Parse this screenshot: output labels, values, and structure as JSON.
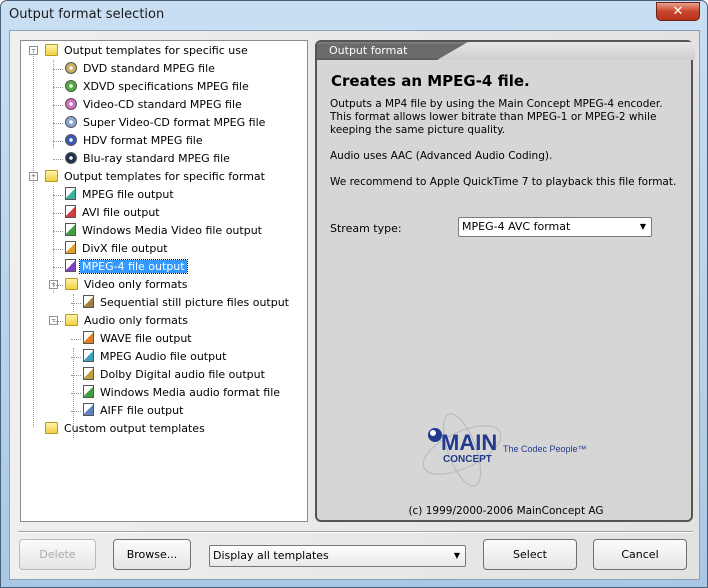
{
  "window": {
    "title": "Output format selection",
    "close_icon": "close-icon"
  },
  "tree": [
    {
      "label": "Output templates for specific use",
      "level": 0,
      "icon": "folder",
      "expander": "-"
    },
    {
      "label": "DVD standard MPEG file",
      "level": 1,
      "icon": "disc",
      "color": "#c8b060"
    },
    {
      "label": "XDVD specifications MPEG file",
      "level": 1,
      "icon": "disc",
      "color": "#50b040"
    },
    {
      "label": "Video-CD standard MPEG file",
      "level": 1,
      "icon": "disc",
      "color": "#d070c8"
    },
    {
      "label": "Super Video-CD format MPEG file",
      "level": 1,
      "icon": "disc",
      "color": "#8aa8d8"
    },
    {
      "label": "HDV format MPEG file",
      "level": 1,
      "icon": "disc",
      "color": "#3a5ab0"
    },
    {
      "label": "Blu-ray standard MPEG file",
      "level": 1,
      "icon": "disc",
      "color": "#203050"
    },
    {
      "label": "Output templates for specific format",
      "level": 0,
      "icon": "folder",
      "expander": "-"
    },
    {
      "label": "MPEG file output",
      "level": 1,
      "icon": "file",
      "color": "#40b0a0"
    },
    {
      "label": "AVI file output",
      "level": 1,
      "icon": "file",
      "color": "#d04040"
    },
    {
      "label": "Windows Media Video file output",
      "level": 1,
      "icon": "file",
      "color": "#40a040"
    },
    {
      "label": "DivX file output",
      "level": 1,
      "icon": "file",
      "color": "#e0a020"
    },
    {
      "label": "MPEG-4 file output",
      "level": 1,
      "icon": "file",
      "color": "#8040c0",
      "selected": true
    },
    {
      "label": "Video only formats",
      "level": 1,
      "icon": "folder",
      "expander": "-"
    },
    {
      "label": "Sequential still picture files output",
      "level": 2,
      "icon": "file",
      "color": "#a08040"
    },
    {
      "label": "Audio only formats",
      "level": 1,
      "icon": "folder",
      "expander": "-"
    },
    {
      "label": "WAVE file output",
      "level": 2,
      "icon": "file",
      "color": "#e08020"
    },
    {
      "label": "MPEG Audio file output",
      "level": 2,
      "icon": "file",
      "color": "#40a0c0"
    },
    {
      "label": "Dolby Digital audio file output",
      "level": 2,
      "icon": "file",
      "color": "#c0a040"
    },
    {
      "label": "Windows Media audio format file",
      "level": 2,
      "icon": "file",
      "color": "#40a040"
    },
    {
      "label": "AIFF file output",
      "level": 2,
      "icon": "file",
      "color": "#6080c0"
    },
    {
      "label": "Custom output templates",
      "level": 0,
      "icon": "folder"
    }
  ],
  "panel": {
    "tab": "Output format",
    "heading": "Creates an MPEG-4 file.",
    "paragraphs": [
      "Outputs a MP4 file by using the Main Concept MPEG-4 encoder. This format allows lower bitrate than MPEG-1 or MPEG-2 while keeping the same picture quality.",
      "Audio uses AAC (Advanced Audio Coding).",
      "We recommend to Apple QuickTime 7 to playback this file format."
    ],
    "stream_label": "Stream type:",
    "stream_value": "MPEG-4 AVC format",
    "logo": {
      "main": "MAIN",
      "concept": "CONCEPT",
      "tagline": "The Codec People™"
    },
    "copyright": "(c) 1999/2000-2006 MainConcept AG"
  },
  "footer": {
    "delete": "Delete",
    "browse": "Browse...",
    "filter": "Display all templates",
    "select": "Select",
    "cancel": "Cancel"
  }
}
